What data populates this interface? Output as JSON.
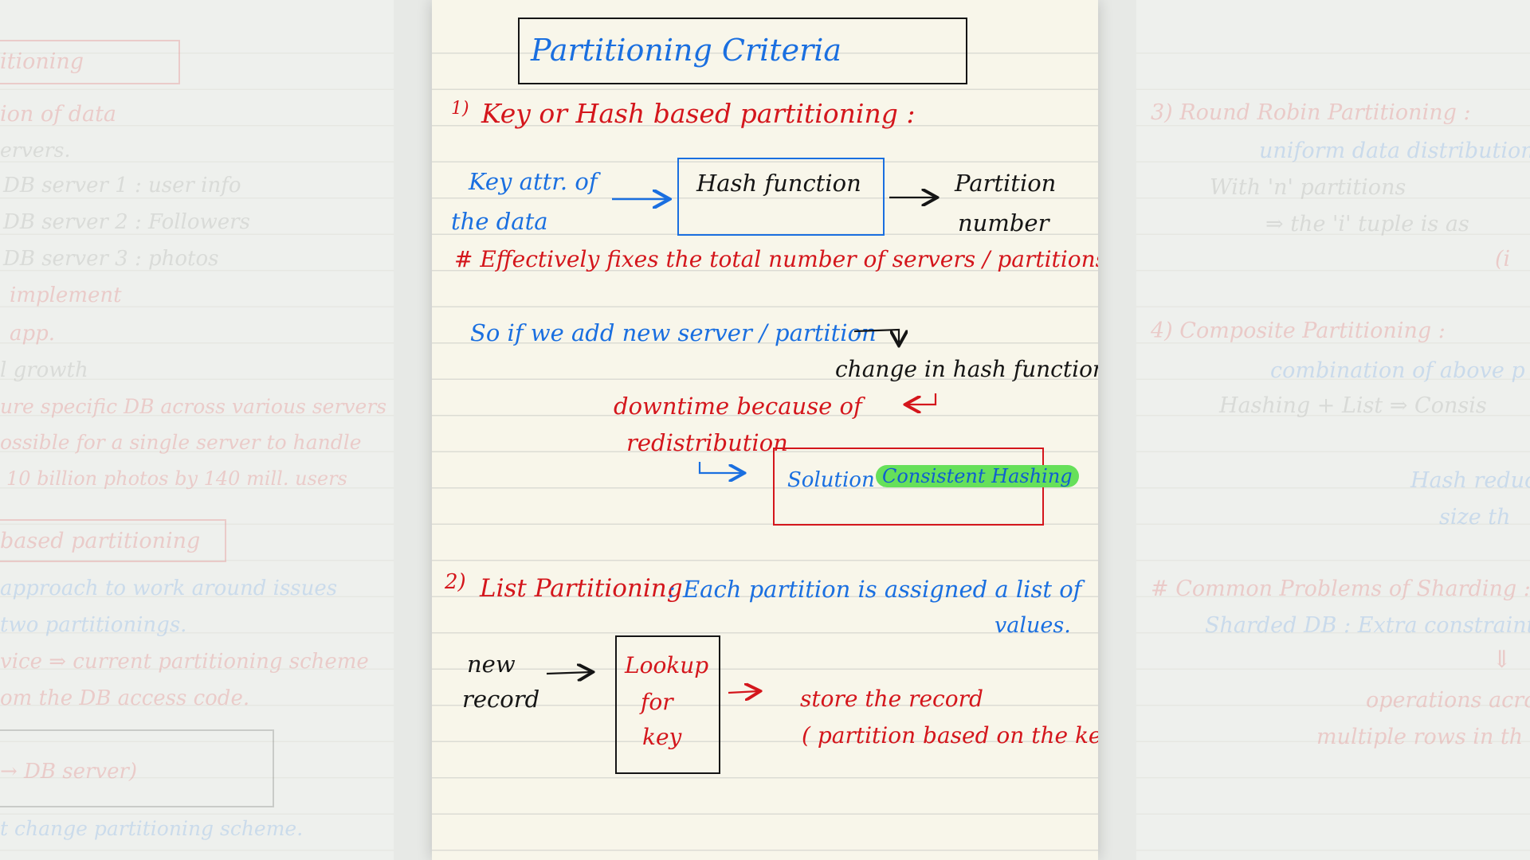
{
  "left_page": {
    "lines": [
      {
        "id": "l1",
        "text": "itioning",
        "color": "red"
      },
      {
        "id": "l2",
        "text": "ion of data",
        "color": "red"
      },
      {
        "id": "l3",
        "text": "ervers.",
        "color": "gray"
      },
      {
        "id": "l4",
        "text": "DB server 1 : user info",
        "color": "gray"
      },
      {
        "id": "l5",
        "text": "DB server 2 : Followers",
        "color": "gray"
      },
      {
        "id": "l6",
        "text": "DB server 3 : photos",
        "color": "gray"
      },
      {
        "id": "l7",
        "text": "implement",
        "color": "red"
      },
      {
        "id": "l8",
        "text": "app.",
        "color": "red"
      },
      {
        "id": "l9",
        "text": "l growth",
        "color": "gray"
      },
      {
        "id": "l10",
        "text": "ure specific DB across various servers",
        "color": "red"
      },
      {
        "id": "l11",
        "text": "ossible for a single server to handle",
        "color": "red"
      },
      {
        "id": "l12",
        "text": "10 billion photos by 140 mill. users",
        "color": "red"
      },
      {
        "id": "l13",
        "text": "based partitioning",
        "color": "red"
      },
      {
        "id": "l14",
        "text": "approach to work around issues",
        "color": "blue"
      },
      {
        "id": "l15",
        "text": "two partitionings.",
        "color": "blue"
      },
      {
        "id": "l16",
        "text": "vice ⇒ current partitioning scheme",
        "color": "red"
      },
      {
        "id": "l17",
        "text": "om the DB access code.",
        "color": "red"
      },
      {
        "id": "l18",
        "text": "→ DB server)",
        "color": "red"
      },
      {
        "id": "l19",
        "text": "t change partitioning scheme.",
        "color": "blue"
      }
    ]
  },
  "center_page": {
    "title": "Partitioning Criteria",
    "section1": {
      "number": "1)",
      "heading": "Key or Hash based partitioning :",
      "input_line1": "Key attr. of",
      "input_line2": "the data",
      "box_label": "Hash function",
      "output_line1": "Partition",
      "output_line2": "number",
      "note": "# Effectively fixes the total number of servers / partitions",
      "consequence": "So if we add new server / partition",
      "change": "change in hash function",
      "downtime_line1": "downtime because of",
      "downtime_line2": "redistribution",
      "solution_label": "Solution :",
      "solution_value": "Consistent Hashing"
    },
    "section2": {
      "number": "2)",
      "heading": "List Partitioning",
      "desc_line1": ": Each partition is assigned a list of",
      "desc_line2": "values.",
      "input_line1": "new",
      "input_line2": "record",
      "box_line1": "Lookup",
      "box_line2": "for",
      "box_line3": "key",
      "output_line1": "store the record",
      "output_line2": "( partition based on the key)"
    }
  },
  "right_page": {
    "lines": [
      {
        "id": "r1",
        "text": "3) Round Robin Partitioning :",
        "color": "red"
      },
      {
        "id": "r2",
        "text": "uniform data distribution",
        "color": "blue"
      },
      {
        "id": "r3",
        "text": "With 'n' partitions",
        "color": "gray"
      },
      {
        "id": "r4",
        "text": "⇒ the 'i' tuple is as",
        "color": "gray"
      },
      {
        "id": "r5",
        "text": "(i",
        "color": "red"
      },
      {
        "id": "r6",
        "text": "4) Composite Partitioning :",
        "color": "red"
      },
      {
        "id": "r7",
        "text": "combination of above p",
        "color": "blue"
      },
      {
        "id": "r8",
        "text": "Hashing + List ⇒ Consis",
        "color": "gray"
      },
      {
        "id": "r8b",
        "text": "",
        "color": "red"
      },
      {
        "id": "r9",
        "text": "Hash reduce",
        "color": "blue"
      },
      {
        "id": "r10",
        "text": "size th",
        "color": "blue"
      },
      {
        "id": "r11",
        "text": "# Common Problems of Sharding :",
        "color": "red"
      },
      {
        "id": "r12",
        "text": "Sharded DB : Extra constraints",
        "color": "blue"
      },
      {
        "id": "r13",
        "text": "⇓",
        "color": "red"
      },
      {
        "id": "r14",
        "text": "operations across",
        "color": "red"
      },
      {
        "id": "r15",
        "text": "multiple rows in th",
        "color": "red"
      }
    ]
  },
  "colors": {
    "blue_ink": "#1a6fe0",
    "red_ink": "#d4161c",
    "black_ink": "#151515",
    "highlight": "#66e05a",
    "paper": "#f8f6ea"
  }
}
